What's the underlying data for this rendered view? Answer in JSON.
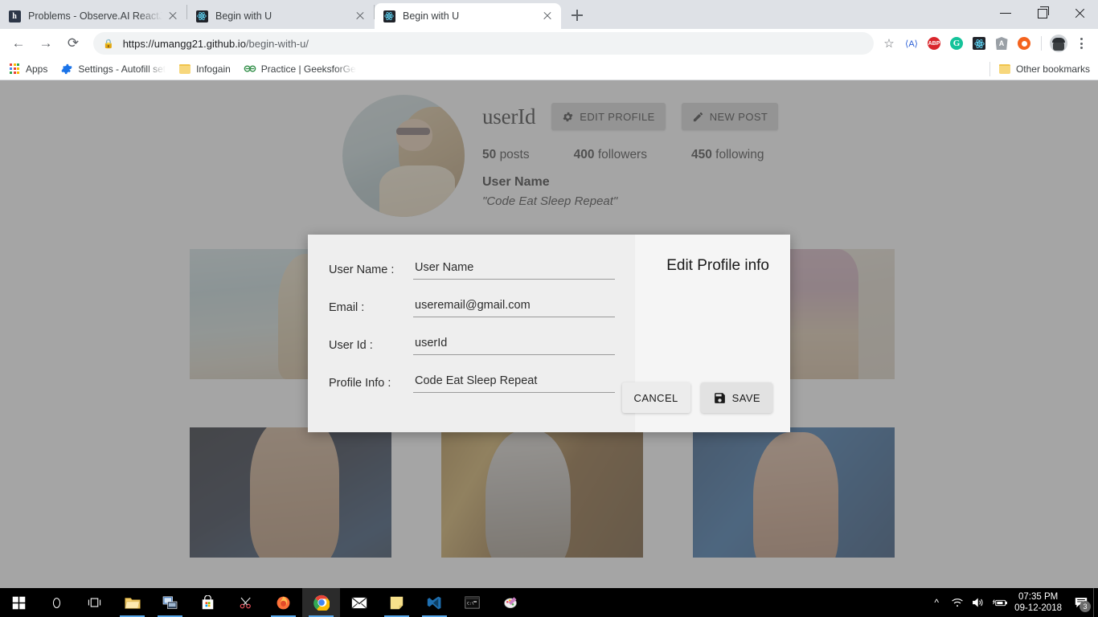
{
  "browser": {
    "tabs": [
      {
        "title": "Problems - Observe.AI ReactJs Hi",
        "favicon": "hackerrank-icon",
        "active": false
      },
      {
        "title": "Begin with U",
        "favicon": "react-icon",
        "active": false
      },
      {
        "title": "Begin with U",
        "favicon": "react-icon",
        "active": true
      }
    ],
    "new_tab_label": "+",
    "window_controls": {
      "minimize": "minimize-icon",
      "maximize": "restore-icon",
      "close": "close-icon"
    },
    "toolbar": {
      "back": "back-arrow-icon",
      "forward": "forward-arrow-icon",
      "reload": "reload-icon",
      "lock": "lock-icon",
      "url_domain": "https://umangg21.github.io",
      "url_path": "/begin-with-u/",
      "bookmark_star": "star-icon",
      "extensions": [
        "axe-icon",
        "abp-icon",
        "grammarly-icon",
        "react-devtools-icon",
        "angular-icon",
        "orange-dot-icon"
      ],
      "profile_avatar": "avatar-icon",
      "menu": "kebab-menu-icon"
    },
    "bookmarks": [
      {
        "label": "Apps",
        "icon": "apps-grid-icon"
      },
      {
        "label": "Settings - Autofill set",
        "icon": "gear-icon"
      },
      {
        "label": "Infogain",
        "icon": "folder-icon"
      },
      {
        "label": "Practice | GeeksforGe",
        "icon": "geeksforgeeks-icon"
      }
    ],
    "other_bookmarks": {
      "label": "Other bookmarks",
      "icon": "folder-icon"
    }
  },
  "profile": {
    "avatar": "profile-photo",
    "user_id": "userId",
    "edit_profile_label": "EDIT PROFILE",
    "edit_profile_icon": "gear-icon",
    "new_post_label": "NEW POST",
    "new_post_icon": "pencil-icon",
    "stats": [
      {
        "value": "50",
        "label": "posts"
      },
      {
        "value": "400",
        "label": "followers"
      },
      {
        "value": "450",
        "label": "following"
      }
    ],
    "real_name": "User Name",
    "bio": "\"Code Eat Sleep Repeat\""
  },
  "gallery": {
    "posts": [
      {
        "name": "post-beach-1"
      },
      {
        "name": "post-sand-2"
      },
      {
        "name": "post-fashion-3"
      },
      {
        "name": "post-portrait-4"
      },
      {
        "name": "post-portrait-5"
      },
      {
        "name": "post-portrait-6"
      }
    ]
  },
  "modal": {
    "title": "Edit Profile info",
    "fields": [
      {
        "label": "User Name :",
        "value": "User Name",
        "name": "user-name-field"
      },
      {
        "label": "Email :",
        "value": "useremail@gmail.com",
        "name": "email-field"
      },
      {
        "label": "User Id :",
        "value": "userId",
        "name": "user-id-field"
      },
      {
        "label": "Profile Info :",
        "value": "Code Eat Sleep Repeat",
        "name": "profile-info-field"
      }
    ],
    "cancel_label": "CANCEL",
    "save_label": "SAVE",
    "save_icon": "floppy-disk-icon"
  },
  "taskbar": {
    "start": "windows-start-icon",
    "items": [
      "cortana-search-icon",
      "task-view-icon",
      "file-explorer-icon",
      "remote-desktop-icon",
      "microsoft-store-icon",
      "snipping-tool-icon",
      "firefox-icon",
      "chrome-icon",
      "mail-icon",
      "sticky-notes-icon",
      "vs-code-icon",
      "command-prompt-icon",
      "paint-3d-icon"
    ],
    "tray": {
      "expand": "chevron-up-icon",
      "wifi": "wifi-icon",
      "volume": "speaker-icon",
      "battery": "battery-charging-icon",
      "time": "07:35 PM",
      "date": "09-12-2018",
      "notifications_icon": "action-center-icon",
      "notifications_count": "3"
    }
  },
  "colors": {
    "accent": "#57a6e8",
    "modal_left_bg": "#eeeeee",
    "modal_right_bg": "#f5f5f5",
    "overlay": "#6e6e6e",
    "taskbar_bg": "#000000"
  }
}
